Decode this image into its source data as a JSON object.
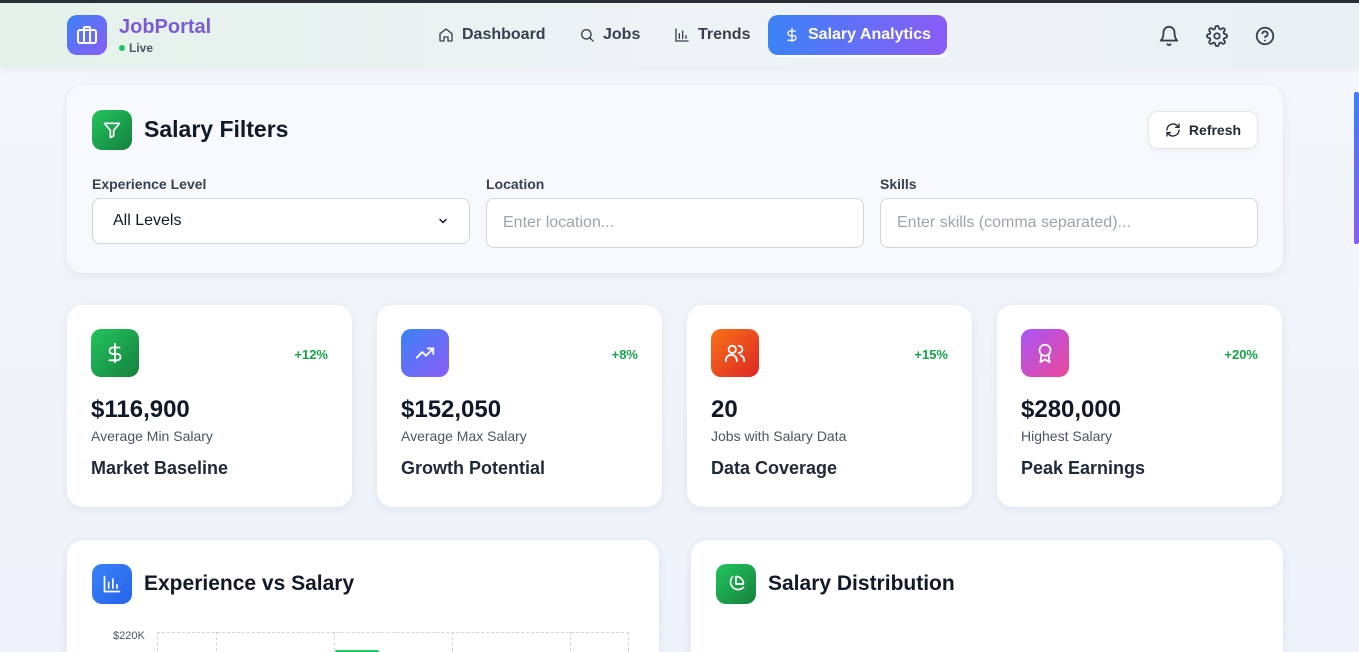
{
  "header": {
    "brand": "JobPortal",
    "status": "Live",
    "nav": [
      {
        "label": "Dashboard",
        "icon": "home-icon"
      },
      {
        "label": "Jobs",
        "icon": "search-icon"
      },
      {
        "label": "Trends",
        "icon": "bar-chart-icon"
      },
      {
        "label": "Salary Analytics",
        "icon": "dollar-icon",
        "active": true
      }
    ],
    "icons": [
      "bell-icon",
      "gear-icon",
      "help-icon"
    ]
  },
  "filters": {
    "title": "Salary Filters",
    "refresh_label": "Refresh",
    "experience": {
      "label": "Experience Level",
      "value": "All Levels"
    },
    "location": {
      "label": "Location",
      "placeholder": "Enter location..."
    },
    "skills": {
      "label": "Skills",
      "placeholder": "Enter skills (comma separated)..."
    }
  },
  "stats": [
    {
      "icon": "dollar-icon",
      "change": "+12%",
      "value": "$116,900",
      "label": "Average Min Salary",
      "title": "Market Baseline",
      "color_from": "#22c55e",
      "color_to": "#15803d"
    },
    {
      "icon": "trending-up-icon",
      "change": "+8%",
      "value": "$152,050",
      "label": "Average Max Salary",
      "title": "Growth Potential",
      "color_from": "#3b82f6",
      "color_to": "#8b5cf6"
    },
    {
      "icon": "users-icon",
      "change": "+15%",
      "value": "20",
      "label": "Jobs with Salary Data",
      "title": "Data Coverage",
      "color_from": "#f97316",
      "color_to": "#dc2626"
    },
    {
      "icon": "award-icon",
      "change": "+20%",
      "value": "$280,000",
      "label": "Highest Salary",
      "title": "Peak Earnings",
      "color_from": "#a855f7",
      "color_to": "#ec4899"
    }
  ],
  "charts": {
    "experience": {
      "title": "Experience vs Salary",
      "y_top_tick": "$220K"
    },
    "distribution": {
      "title": "Salary Distribution"
    }
  },
  "colors": {
    "accent_from": "#3b82f6",
    "accent_to": "#8b5cf6",
    "positive": "#16a34a"
  }
}
